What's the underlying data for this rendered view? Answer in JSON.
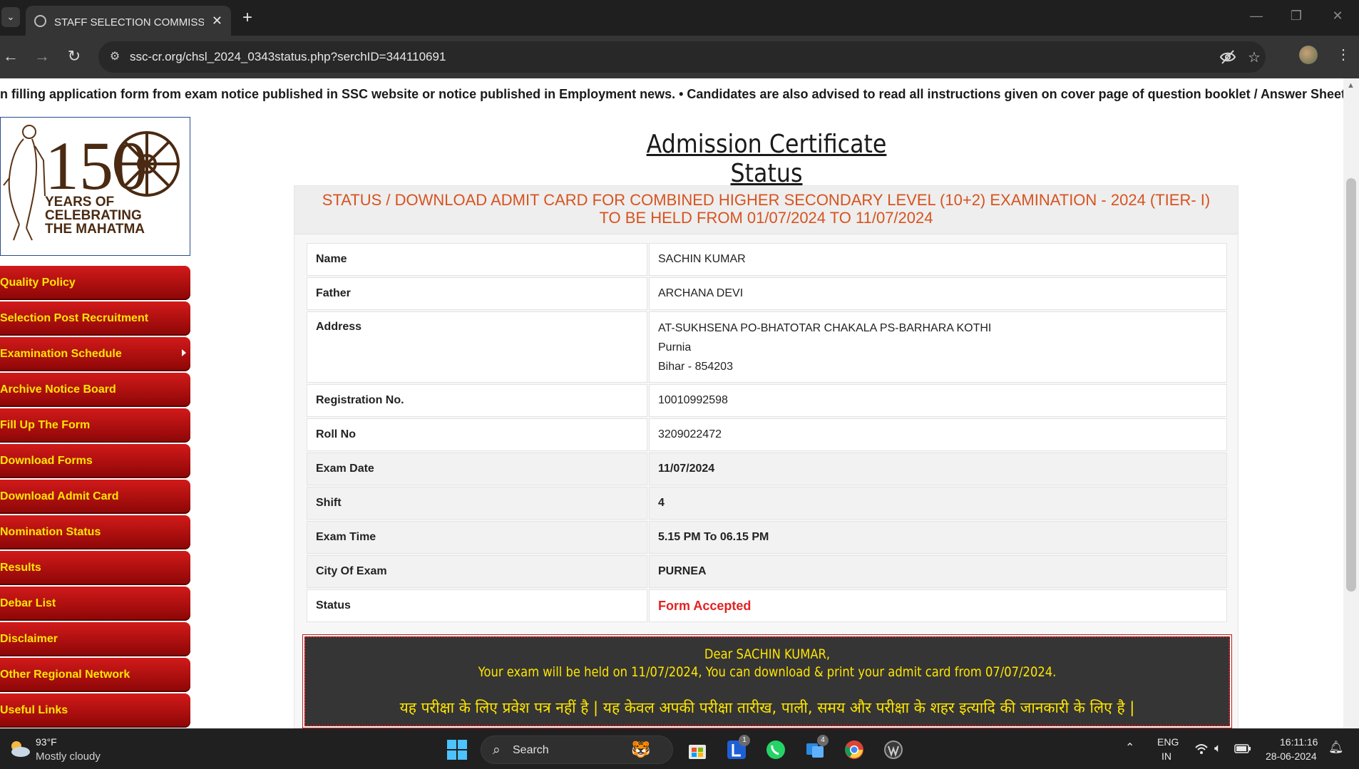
{
  "browser": {
    "tab_title": "STAFF SELECTION COMMISSION",
    "tab_close": "✕",
    "new_tab": "+",
    "url": "ssc-cr.org/chsl_2024_0343status.php?serchID=344110691"
  },
  "marquee": "n filling application form from exam notice published in SSC website or notice published in Employment news.  • Candidates are also advised to read all instructions given on cover page of question booklet / Answer Sheet before",
  "logo": {
    "number": "150",
    "line1": "YEARS OF",
    "line2": "CELEBRATING",
    "line3": "THE MAHATMA"
  },
  "sidebar": {
    "items": [
      {
        "label": "Quality Policy"
      },
      {
        "label": "Selection Post Recruitment"
      },
      {
        "label": "Examination Schedule"
      },
      {
        "label": "Archive Notice Board"
      },
      {
        "label": "Fill Up The Form"
      },
      {
        "label": "Download Forms"
      },
      {
        "label": "Download Admit Card"
      },
      {
        "label": "Nomination Status"
      },
      {
        "label": "Results"
      },
      {
        "label": "Debar List"
      },
      {
        "label": "Disclaimer"
      },
      {
        "label": "Other Regional Network"
      },
      {
        "label": "Useful Links"
      }
    ]
  },
  "main": {
    "heading": "Admission Certificate Status",
    "panel_title_line1": "STATUS / DOWNLOAD ADMIT CARD FOR COMBINED HIGHER SECONDARY LEVEL (10+2) EXAMINATION - 2024 (TIER- I)",
    "panel_title_line2": "TO BE HELD FROM 01/07/2024 TO 11/07/2024",
    "rows": [
      {
        "key": "Name",
        "value": "SACHIN KUMAR"
      },
      {
        "key": "Father",
        "value": "ARCHANA DEVI"
      },
      {
        "key": "Address",
        "line1": "AT-SUKHSENA PO-BHATOTAR CHAKALA PS-BARHARA KOTHI",
        "line2": "Purnia",
        "line3": "Bihar - 854203"
      },
      {
        "key": "Registration No.",
        "value": "10010992598"
      },
      {
        "key": "Roll No",
        "value": "3209022472"
      },
      {
        "key": "Exam Date",
        "value": "11/07/2024"
      },
      {
        "key": "Shift",
        "value": "4"
      },
      {
        "key": "Exam Time",
        "value": "5.15 PM To 06.15 PM"
      },
      {
        "key": "City Of Exam",
        "value": "PURNEA"
      },
      {
        "key": "Status",
        "value": "Form Accepted"
      }
    ],
    "notice": {
      "line1": "Dear SACHIN KUMAR,",
      "line2": "Your exam will be held on 11/07/2024, You can download & print your admit card from 07/07/2024.",
      "line3": "यह परीक्षा के लिए प्रवेश पत्र नहीं है | यह केवल अपकी परीक्षा तारीख, पाली, समय और परीक्षा के शहर इत्यादि की जानकारी के लिए है |"
    }
  },
  "taskbar": {
    "temp": "93°F",
    "weather": "Mostly cloudy",
    "search_label": "Search",
    "badge_1": "1",
    "badge_4": "4",
    "lang1": "ENG",
    "lang2": "IN",
    "time": "16:11:16",
    "date": "28-06-2024"
  },
  "colors": {
    "menu_red": "#b01010",
    "menu_text": "#ffe600",
    "panel_title": "#d7531f",
    "status_red": "#e32222",
    "notice_bg": "#353535"
  }
}
